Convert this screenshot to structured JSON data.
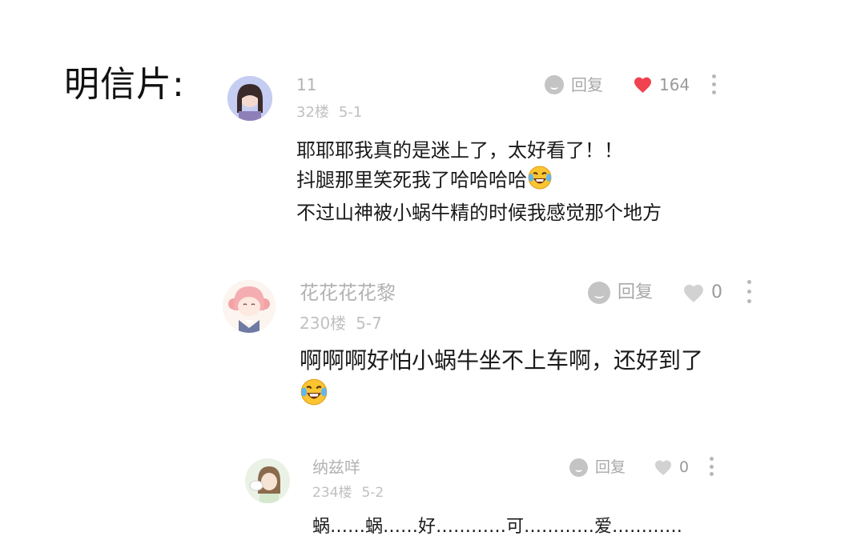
{
  "page": {
    "title": "明信片:"
  },
  "comments": [
    {
      "username": "11",
      "floor": "32楼",
      "date": "5-1",
      "reply_label": "回复",
      "like_count": "164",
      "liked": true,
      "lines": [
        "耶耶耶我真的是迷上了，太好看了！！",
        "抖腿那里笑死我了哈哈哈哈",
        "不过山神被小蜗牛精的时候我感觉那个地方"
      ]
    },
    {
      "username": "花花花花黎",
      "floor": "230楼",
      "date": "5-7",
      "reply_label": "回复",
      "like_count": "0",
      "liked": false,
      "lines": [
        "啊啊啊好怕小蜗牛坐不上车啊，还好到了"
      ]
    },
    {
      "username": "纳兹咩",
      "floor": "234楼",
      "date": "5-2",
      "reply_label": "回复",
      "like_count": "0",
      "liked": false,
      "lines": [
        "蜗……蜗……好…………可…………爱…………"
      ]
    }
  ],
  "icons": {
    "reply": "speech-bubble-icon",
    "like_active": "heart-filled-icon",
    "like_inactive": "heart-outline-icon",
    "more": "more-vertical-icon",
    "emoji": "laughing-tears-emoji"
  },
  "colors": {
    "like_active": "#f0434f",
    "like_inactive": "#d2d2d2",
    "muted_text": "#b3b3b3",
    "body_text": "#1a1a1a"
  }
}
